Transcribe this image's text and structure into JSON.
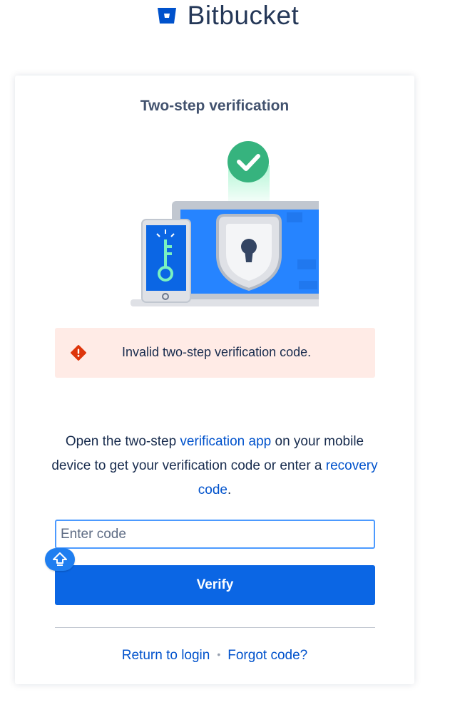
{
  "brand": {
    "name": "Bitbucket",
    "color": "#0052cc"
  },
  "card": {
    "title": "Two-step verification"
  },
  "alert": {
    "message": "Invalid two-step verification code.",
    "icon": "error-icon",
    "color": "#de350b"
  },
  "instructions": {
    "part1": "Open the two-step ",
    "link1": "verification app",
    "part2": " on your mobile device to get your verification code or enter a ",
    "link2": "recovery code",
    "part3": "."
  },
  "code_input": {
    "value": "",
    "placeholder": "Enter code"
  },
  "verify_button": {
    "label": "Verify"
  },
  "footer": {
    "return_link": "Return to login",
    "separator": "•",
    "forgot_link": "Forgot code?"
  },
  "colors": {
    "primary": "#0b66e4",
    "link": "#0052cc",
    "success": "#36b37e",
    "alert_bg": "#ffebe6"
  }
}
